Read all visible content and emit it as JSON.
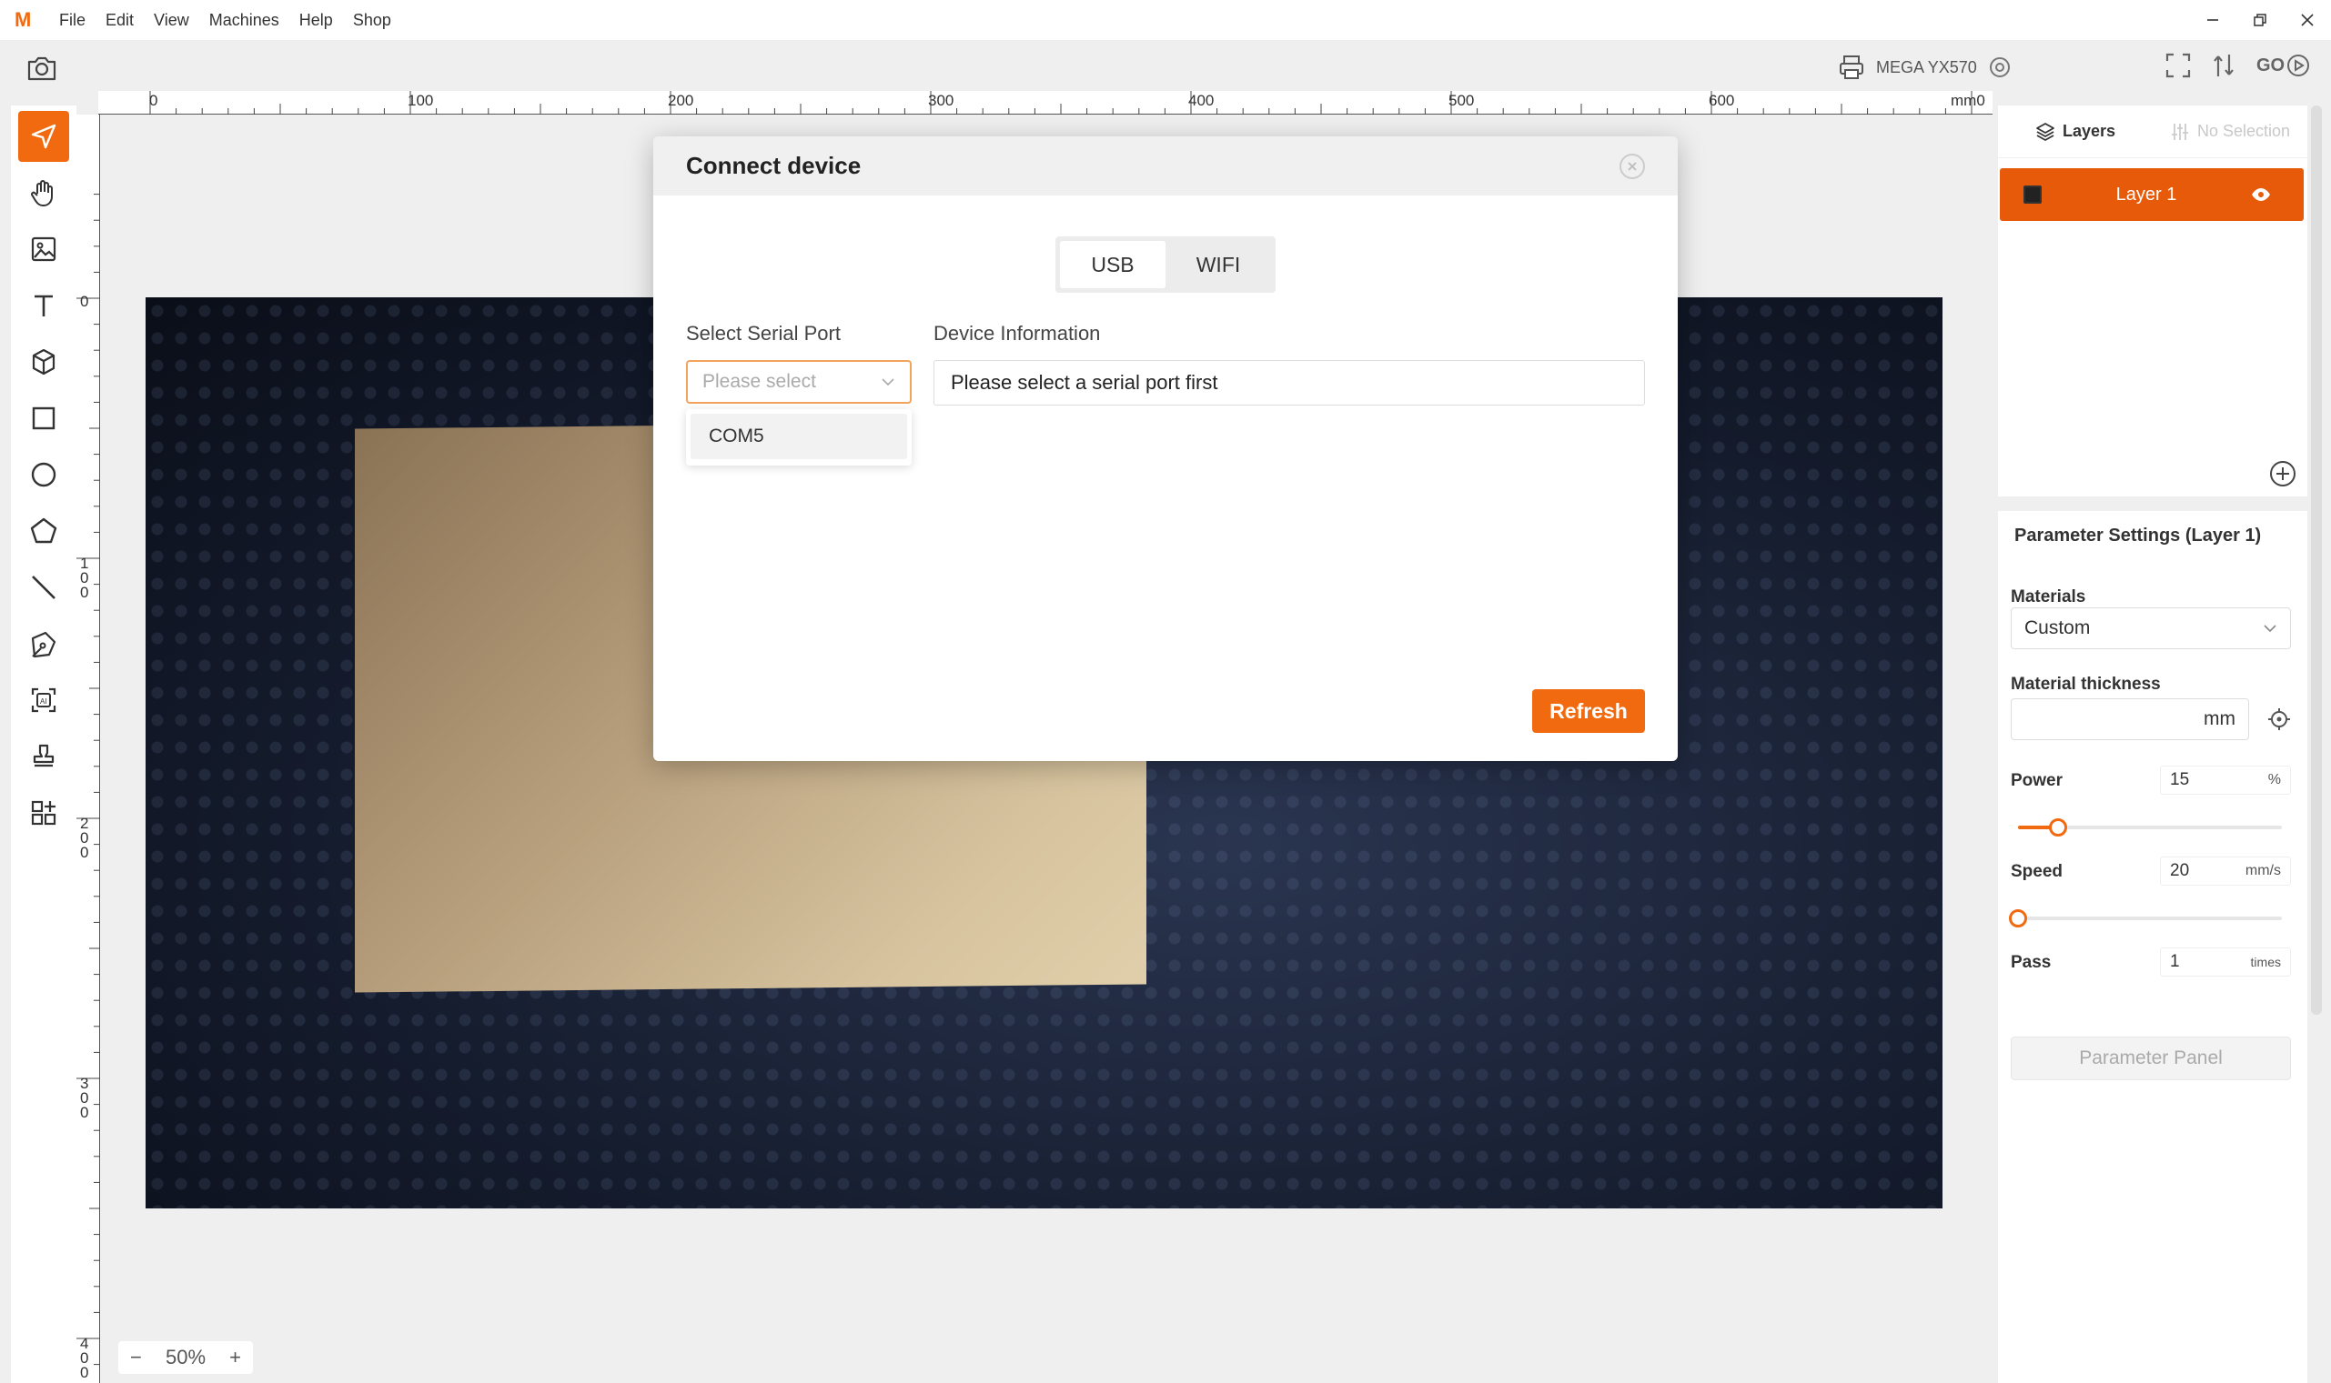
{
  "app": {
    "logo": "M"
  },
  "menu": [
    "File",
    "Edit",
    "View",
    "Machines",
    "Help",
    "Shop"
  ],
  "toolbar": {
    "machine_name": "MEGA YX570",
    "go_label": "GO"
  },
  "left_tools": [
    "select-tool-icon",
    "hand-tool-icon",
    "image-tool-icon",
    "text-tool-icon",
    "3d-cube-icon",
    "rectangle-tool-icon",
    "circle-tool-icon",
    "polygon-tool-icon",
    "line-tool-icon",
    "pen-tool-icon",
    "ai-image-icon",
    "stamp-icon",
    "add-apps-icon"
  ],
  "ruler": {
    "top_labels": [
      "0",
      "100",
      "200",
      "300",
      "400",
      "500",
      "600",
      "mm0"
    ],
    "left_labels": [
      "0",
      "1\n0\n0",
      "2\n0\n0",
      "3\n0\n0",
      "4\n0\n0"
    ]
  },
  "zoom": {
    "minus": "−",
    "value": "50%",
    "plus": "+"
  },
  "layers_panel": {
    "tab_layers": "Layers",
    "tab_selection": "No Selection",
    "layers": [
      {
        "name": "Layer 1",
        "color": "#222222"
      }
    ]
  },
  "params": {
    "title": "Parameter Settings (Layer 1)",
    "materials_label": "Materials",
    "materials_value": "Custom",
    "thickness_label": "Material thickness",
    "thickness_value": "",
    "thickness_unit": "mm",
    "power_label": "Power",
    "power_value": "15",
    "power_unit": "%",
    "power_fraction": 0.15,
    "speed_label": "Speed",
    "speed_value": "20",
    "speed_unit": "mm/s",
    "speed_fraction": 0.0,
    "pass_label": "Pass",
    "pass_value": "1",
    "pass_unit": "times",
    "panel_button": "Parameter Panel"
  },
  "modal": {
    "title": "Connect device",
    "tab_usb": "USB",
    "tab_wifi": "WIFI",
    "serial_label": "Select Serial Port",
    "serial_placeholder": "Please select",
    "device_label": "Device Information",
    "device_info": "Please select a serial port first",
    "ports": [
      "COM5"
    ],
    "refresh": "Refresh"
  },
  "colors": {
    "accent": "#f26a0f",
    "layer_row": "#e65a0a"
  }
}
